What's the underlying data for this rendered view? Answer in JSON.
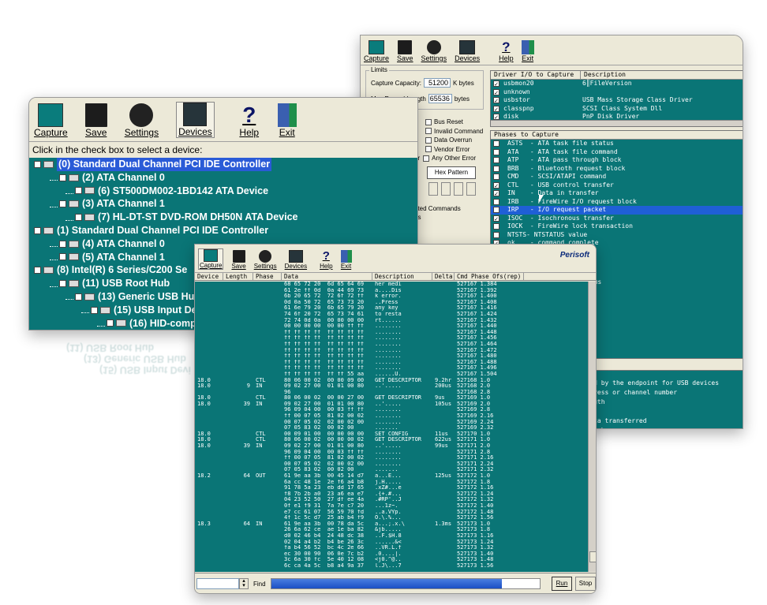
{
  "toolbar": {
    "capture": "Capture",
    "save": "Save",
    "settings": "Settings",
    "devices": "Devices",
    "help": "Help",
    "exit": "Exit"
  },
  "help_glyph": "?",
  "devices_window": {
    "instruction": "Click in the check box to select a device:",
    "tree": [
      {
        "label": "(0) Standard Dual Channel PCI IDE Controller",
        "depth": 0,
        "selected": true
      },
      {
        "label": "(2) ATA Channel 0",
        "depth": 1
      },
      {
        "label": "(6) ST500DM002-1BD142 ATA Device",
        "depth": 2
      },
      {
        "label": "(3) ATA Channel 1",
        "depth": 1
      },
      {
        "label": "(7) HL-DT-ST DVD-ROM DH50N ATA Device",
        "depth": 2
      },
      {
        "label": "(1) Standard Dual Channel PCI IDE Controller",
        "depth": 0
      },
      {
        "label": "(4) ATA Channel 0",
        "depth": 1
      },
      {
        "label": "(5) ATA Channel 1",
        "depth": 1
      },
      {
        "label": "(8) Intel(R) 6 Series/C200 Se",
        "depth": 0
      },
      {
        "label": "(11) USB Root Hub",
        "depth": 1
      },
      {
        "label": "(13) Generic USB Hub",
        "depth": 2
      },
      {
        "label": "(15) USB Input Devi",
        "depth": 3
      },
      {
        "label": "(16) HID-complia",
        "depth": 4
      }
    ],
    "reflection": [
      "(15) USB Input Devi",
      "(13) Generic USB Hub",
      "(11) USB Root Hub"
    ]
  },
  "settings_window": {
    "limits_label": "Limits",
    "capture_capacity_label": "Capture Capacity:",
    "capture_capacity_value": "51200",
    "capture_capacity_unit": "K bytes",
    "max_record_label": "Max Record Length",
    "max_record_value": "65536",
    "max_record_unit": "bytes",
    "options": [
      "Bus Reset",
      "Invalid Command",
      "Data Overrun",
      "Vendor Error",
      "Any Other Error"
    ],
    "or_label": "or",
    "hex_pattern_label": "Hex Pattern",
    "fragments": [
      "ated Commands",
      "ds"
    ],
    "driver_headers": [
      "Driver I/O to Capture",
      "Description"
    ],
    "drivers": [
      {
        "name": "usbmon20",
        "desc": "6║FileVersion",
        "checked": true
      },
      {
        "name": "unknown",
        "desc": "",
        "checked": true
      },
      {
        "name": "usbstor",
        "desc": "USB Mass Storage Class Driver",
        "checked": true
      },
      {
        "name": "classpnp",
        "desc": "SCSI Class System Dll",
        "checked": true
      },
      {
        "name": "disk",
        "desc": "PnP Disk Driver",
        "checked": true
      }
    ],
    "phases_header": "Phases to Capture",
    "phases": [
      {
        "text": "ASTS  - ATA task file status",
        "checked": false
      },
      {
        "text": "ATA   - ATA task file command",
        "checked": false
      },
      {
        "text": "ATP   - ATA pass through block",
        "checked": false
      },
      {
        "text": "BRB   - Bluetooth request block",
        "checked": false
      },
      {
        "text": "CMD   - SCSI/ATAPI command",
        "checked": false
      },
      {
        "text": "CTL   - USB control transfer",
        "checked": true
      },
      {
        "text": "IN    - Data in transfer",
        "checked": true
      },
      {
        "text": "IRB   - FireWire I/O request block",
        "checked": false
      },
      {
        "text": "IRP   - I/O request packet",
        "checked": false,
        "selected": true
      },
      {
        "text": "ISOC  - Isochronous transfer",
        "checked": true
      },
      {
        "text": "IOCK  - FireWire lock transaction",
        "checked": false
      },
      {
        "text": "NTSTS- NTSTATUS value",
        "checked": false
      },
      {
        "text": "ok    - command complete",
        "checked": true
      }
    ],
    "right_fragments": [
      "er",
      "gh block",
      "ock",
      "ock status",
      "son",
      "ck"
    ],
    "desc_lines": [
      "llowed by the endpoint for USB devices",
      "c address or channel number",
      "r length",
      "",
      "he data transferred",
      "f the phase"
    ]
  },
  "capture_window": {
    "brand": "Perisoft",
    "headers": [
      "Device",
      "Length",
      "Phase",
      "Data",
      "Description",
      "Delta",
      "Cmd Phase Ofs(rep)"
    ],
    "rows": [
      {
        "dev": "",
        "len": "",
        "ph": "",
        "data": "68 65 72 20  6d 65 64 69",
        "desc": "her medi",
        "delta": "",
        "cmd": "527167 1.384"
      },
      {
        "dev": "",
        "len": "",
        "ph": "",
        "data": "61 2e ff 0d  0a 44 69 73",
        "desc": "a....Dis",
        "delta": "",
        "cmd": "527167 1.392"
      },
      {
        "dev": "",
        "len": "",
        "ph": "",
        "data": "6b 20 65 72  72 6f 72 ff",
        "desc": "k error.",
        "delta": "",
        "cmd": "527167 1.400"
      },
      {
        "dev": "",
        "len": "",
        "ph": "",
        "data": "0d 0a 50 72  65 73 73 20",
        "desc": "..Press ",
        "delta": "",
        "cmd": "527167 1.408"
      },
      {
        "dev": "",
        "len": "",
        "ph": "",
        "data": "61 6e 79 20  6b 65 79 20",
        "desc": "any key ",
        "delta": "",
        "cmd": "527167 1.416"
      },
      {
        "dev": "",
        "len": "",
        "ph": "",
        "data": "74 6f 20 72  65 73 74 61",
        "desc": "to resta",
        "delta": "",
        "cmd": "527167 1.424"
      },
      {
        "dev": "",
        "len": "",
        "ph": "",
        "data": "72 74 0d 0a  00 00 00 00",
        "desc": "rt......",
        "delta": "",
        "cmd": "527167 1.432"
      },
      {
        "dev": "",
        "len": "",
        "ph": "",
        "data": "00 00 00 00  00 00 ff ff",
        "desc": "........",
        "delta": "",
        "cmd": "527167 1.440"
      },
      {
        "dev": "",
        "len": "",
        "ph": "",
        "data": "ff ff ff ff  ff ff ff ff",
        "desc": "........",
        "delta": "",
        "cmd": "527167 1.448"
      },
      {
        "dev": "",
        "len": "",
        "ph": "",
        "data": "ff ff ff ff  ff ff ff ff",
        "desc": "........",
        "delta": "",
        "cmd": "527167 1.456"
      },
      {
        "dev": "",
        "len": "",
        "ph": "",
        "data": "ff ff ff ff  ff ff ff ff",
        "desc": "........",
        "delta": "",
        "cmd": "527167 1.464"
      },
      {
        "dev": "",
        "len": "",
        "ph": "",
        "data": "ff ff ff ff  ff ff ff ff",
        "desc": "........",
        "delta": "",
        "cmd": "527167 1.472"
      },
      {
        "dev": "",
        "len": "",
        "ph": "",
        "data": "ff ff ff ff  ff ff ff ff",
        "desc": "........",
        "delta": "",
        "cmd": "527167 1.480"
      },
      {
        "dev": "",
        "len": "",
        "ph": "",
        "data": "ff ff ff ff  ff ff ff ff",
        "desc": "........",
        "delta": "",
        "cmd": "527167 1.488"
      },
      {
        "dev": "",
        "len": "",
        "ph": "",
        "data": "ff ff ff ff  ff ff ff ff",
        "desc": "........",
        "delta": "",
        "cmd": "527167 1.496"
      },
      {
        "dev": "",
        "len": "",
        "ph": "",
        "data": "ff ff ff ff  ff ff 55 aa",
        "desc": "......U.",
        "delta": "",
        "cmd": "527167 1.504"
      },
      {
        "dev": "18.0",
        "len": "",
        "ph": "CTL",
        "data": "80 06 00 02  00 00 09 00",
        "desc": "GET DESCRIPTOR",
        "delta": "9.2hr",
        "cmd": "527168 1.0"
      },
      {
        "dev": "18.0",
        "len": "9",
        "ph": "IN",
        "data": "09 02 27 00  01 01 00 80",
        "desc": "..'.....",
        "delta": "200us",
        "cmd": "527168 2.0"
      },
      {
        "dev": "",
        "len": "",
        "ph": "",
        "data": "96",
        "desc": "",
        "delta": "",
        "cmd": "527168 2.8"
      },
      {
        "dev": "18.0",
        "len": "",
        "ph": "CTL",
        "data": "80 06 00 02  00 00 27 00",
        "desc": "GET DESCRIPTOR",
        "delta": "9us",
        "cmd": "527169 1.0"
      },
      {
        "dev": "18.0",
        "len": "39",
        "ph": "IN",
        "data": "09 02 27 00  01 01 00 80",
        "desc": "..'.....",
        "delta": "105us",
        "cmd": "527169 2.0"
      },
      {
        "dev": "",
        "len": "",
        "ph": "",
        "data": "96 09 04 00  00 03 ff ff",
        "desc": "........",
        "delta": "",
        "cmd": "527169 2.8"
      },
      {
        "dev": "",
        "len": "",
        "ph": "",
        "data": "ff 00 07 05  81 02 00 02",
        "desc": "........",
        "delta": "",
        "cmd": "527169 2.16"
      },
      {
        "dev": "",
        "len": "",
        "ph": "",
        "data": "00 07 05 02  02 00 02 00",
        "desc": "........",
        "delta": "",
        "cmd": "527169 2.24"
      },
      {
        "dev": "",
        "len": "",
        "ph": "",
        "data": "07 05 83 02  00 02 00",
        "desc": ".......",
        "delta": "",
        "cmd": "527169 2.32"
      },
      {
        "dev": "18.0",
        "len": "",
        "ph": "CTL",
        "data": "00 09 01 00  00 00 00 00",
        "desc": "SET CONFIG",
        "delta": "11us",
        "cmd": "527170 1.0"
      },
      {
        "dev": "18.0",
        "len": "",
        "ph": "CTL",
        "data": "80 06 00 02  00 00 00 02",
        "desc": "GET DESCRIPTOR",
        "delta": "622us",
        "cmd": "527171 1.0"
      },
      {
        "dev": "18.0",
        "len": "39",
        "ph": "IN",
        "data": "09 02 27 00  01 01 00 80",
        "desc": "..'.....",
        "delta": "99us",
        "cmd": "527171 2.0"
      },
      {
        "dev": "",
        "len": "",
        "ph": "",
        "data": "96 09 04 00  00 03 ff ff",
        "desc": "........",
        "delta": "",
        "cmd": "527171 2.8"
      },
      {
        "dev": "",
        "len": "",
        "ph": "",
        "data": "ff 00 07 05  81 02 00 02",
        "desc": "........",
        "delta": "",
        "cmd": "527171 2.16"
      },
      {
        "dev": "",
        "len": "",
        "ph": "",
        "data": "00 07 05 02  02 00 02 00",
        "desc": "........",
        "delta": "",
        "cmd": "527171 2.24"
      },
      {
        "dev": "",
        "len": "",
        "ph": "",
        "data": "07 05 83 02  00 02 00",
        "desc": ".......",
        "delta": "",
        "cmd": "527171 2.32"
      },
      {
        "dev": "18.2",
        "len": "64",
        "ph": "OUT",
        "data": "61 9e aa 3b  00 45 14 d7",
        "desc": "a...E...",
        "delta": "125us",
        "cmd": "527172 1.0"
      },
      {
        "dev": "",
        "len": "",
        "ph": "",
        "data": "6a cc 48 1e  2e f6 a4 b8",
        "desc": "j.H.....",
        "delta": "",
        "cmd": "527172 1.8"
      },
      {
        "dev": "",
        "len": "",
        "ph": "",
        "data": "91 78 5a 23  eb dd 17 65",
        "desc": ".xZ#...e",
        "delta": "",
        "cmd": "527172 1.16"
      },
      {
        "dev": "",
        "len": "",
        "ph": "",
        "data": "f8 7b 2b a0  23 a6 ea e7",
        "desc": ".{+.#...",
        "delta": "",
        "cmd": "527172 1.24"
      },
      {
        "dev": "",
        "len": "",
        "ph": "",
        "data": "04 23 52 50  27 df ee 4a",
        "desc": ".#RP'..J",
        "delta": "",
        "cmd": "527172 1.32"
      },
      {
        "dev": "",
        "len": "",
        "ph": "",
        "data": "0f e1 f9 31  7a 7e c7 20",
        "desc": "...1z~. ",
        "delta": "",
        "cmd": "527172 1.40"
      },
      {
        "dev": "",
        "len": "",
        "ph": "",
        "data": "e7 cc 61 07  56 59 70 fd",
        "desc": "..a.VYp.",
        "delta": "",
        "cmd": "527172 1.48"
      },
      {
        "dev": "",
        "len": "",
        "ph": "",
        "data": "4f 1c 5c d7  25 ab b4 f9",
        "desc": "O.\\.%...",
        "delta": "",
        "cmd": "527172 1.56"
      },
      {
        "dev": "18.3",
        "len": "64",
        "ph": "IN",
        "data": "61 9e aa 3b  00 78 da 5c",
        "desc": "a...;.x.\\",
        "delta": "1.3ms",
        "cmd": "527173 1.0"
      },
      {
        "dev": "",
        "len": "",
        "ph": "",
        "data": "26 6a 62 ce  ae 1e ba 82",
        "desc": "&jb.....",
        "delta": "",
        "cmd": "527173 1.8"
      },
      {
        "dev": "",
        "len": "",
        "ph": "",
        "data": "d0 02 46 b4  24 48 dc 38",
        "desc": "..F.$H.8",
        "delta": "",
        "cmd": "527173 1.16"
      },
      {
        "dev": "",
        "len": "",
        "ph": "",
        "data": "02 04 a4 b2  b4 be 26 3c",
        "desc": "......&<",
        "delta": "",
        "cmd": "527173 1.24"
      },
      {
        "dev": "",
        "len": "",
        "ph": "",
        "data": "fa b4 56 52  bc 4c 2e 66",
        "desc": "..VR.L.f",
        "delta": "",
        "cmd": "527173 1.32"
      },
      {
        "dev": "",
        "len": "",
        "ph": "",
        "data": "ec 30 00 90  06 0e 7c b2",
        "desc": ".0....|.",
        "delta": "",
        "cmd": "527173 1.40"
      },
      {
        "dev": "",
        "len": "",
        "ph": "",
        "data": "3c 6a 30 fc  5e 40 12 08",
        "desc": "<j0.^@..",
        "delta": "",
        "cmd": "527173 1.48"
      },
      {
        "dev": "",
        "len": "",
        "ph": "",
        "data": "6c ca 4a 5c  b8 a4 9a 37",
        "desc": "l.J\\...7",
        "delta": "",
        "cmd": "527173 1.56"
      }
    ],
    "find_label": "Find",
    "progress_fraction": 0.86,
    "run_label": "Run",
    "stop_label": "Stop"
  }
}
